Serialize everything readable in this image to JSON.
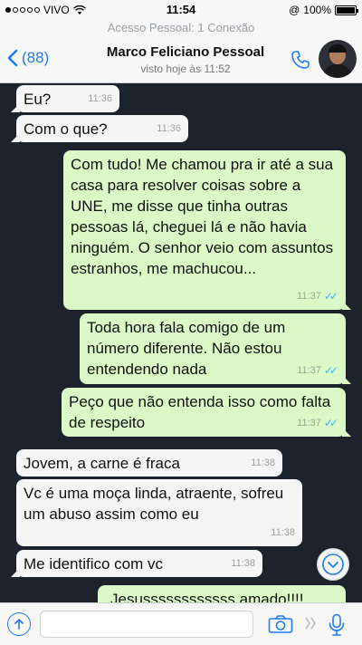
{
  "status": {
    "carrier": "VIVO",
    "time": "11:54",
    "battery": "100%"
  },
  "banner": "Acesso Pessoal: 1 Conexão",
  "header": {
    "back_count": "(88)",
    "name": "Marco Feliciano Pessoal",
    "seen": "visto hoje às 11:52"
  },
  "messages": [
    {
      "dir": "in",
      "text": "Eu?",
      "time": "11:36"
    },
    {
      "dir": "in",
      "text": "Com o que?",
      "time": "11:36"
    },
    {
      "dir": "out",
      "text": "Com tudo! Me chamou pra ir até a sua casa para resolver coisas sobre a UNE, me disse que tinha outras pessoas lá, cheguei lá e não havia ninguém. O senhor veio com assuntos estranhos, me machucou...",
      "time": "11:37",
      "read": true
    },
    {
      "dir": "out",
      "text": "Toda hora fala comigo de um número diferente. Não estou entendendo nada",
      "time": "11:37",
      "read": true
    },
    {
      "dir": "out",
      "text": "Peço que não entenda isso como falta de respeito",
      "time": "11:37",
      "read": true
    },
    {
      "dir": "in",
      "text": "Jovem, a carne é fraca",
      "time": "11:38"
    },
    {
      "dir": "in",
      "text": "Vc é uma moça linda, atraente, sofreu um abuso assim como eu",
      "time": "11:38"
    },
    {
      "dir": "in",
      "text": "Me identifico com vc",
      "time": "11:38"
    },
    {
      "dir": "out",
      "text": "Jesussssssssssss amado!!!!",
      "time": "",
      "read": false
    }
  ],
  "input": {
    "placeholder": ""
  },
  "colors": {
    "accent": "#1f7cf1",
    "outgoing": "#dcf8c6",
    "incoming": "#f5f5f5",
    "read_ticks": "#34b7f1"
  },
  "icons": {
    "back": "chevron-left-icon",
    "call": "phone-icon",
    "scroll": "chevron-down-icon",
    "attach": "arrow-up-icon",
    "camera": "camera-icon",
    "sticker": "sticker-icon",
    "mic": "microphone-icon"
  }
}
